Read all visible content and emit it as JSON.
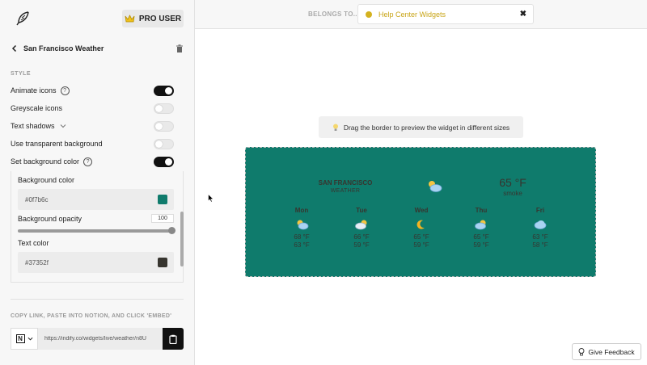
{
  "header": {
    "logo_icon": "feather-icon",
    "pro_badge_label": "PRO USER",
    "pro_badge_icon": "crown-icon"
  },
  "widget_header": {
    "title": "San Francisco Weather",
    "back_icon": "chevron-left-icon",
    "delete_icon": "trash-icon"
  },
  "style_section": {
    "label": "STYLE",
    "options": [
      {
        "label": "Animate icons",
        "has_help": true,
        "on": true
      },
      {
        "label": "Greyscale icons",
        "has_help": false,
        "on": false
      },
      {
        "label": "Text shadows",
        "has_dropdown": true,
        "on": false
      },
      {
        "label": "Use transparent background",
        "on": false
      },
      {
        "label": "Set background color",
        "has_help": true,
        "on": true
      }
    ],
    "background_color_label": "Background color",
    "background_color_value": "#0f7b6c",
    "background_opacity_label": "Background opacity",
    "background_opacity_value": "100",
    "text_color_label": "Text color",
    "text_color_value": "#37352f"
  },
  "embed": {
    "label": "COPY LINK, PASTE INTO NOTION, AND CLICK 'EMBED'",
    "url": "https://indify.co/widgets/live/weather/n8U",
    "notion_icon": "notion-icon",
    "copy_icon": "clipboard-icon"
  },
  "topbar": {
    "belongs_label": "BELONGS TO...",
    "folder_name": "Help Center Widgets",
    "folder_color": "#d4b21f",
    "close_label": "✖"
  },
  "hint": {
    "icon": "lightbulb-icon",
    "text": "Drag the border to preview the widget in different sizes"
  },
  "weather": {
    "bg_color": "#0f7b6c",
    "text_color": "#37352f",
    "city": "SAN FRANCISCO",
    "city_sub": "WEATHER",
    "current_temp": "65 °F",
    "current_condition": "smoke",
    "current_icon": "partly-cloudy-icon",
    "days": [
      {
        "name": "Mon",
        "icon": "partly-cloudy-icon",
        "high": "68 °F",
        "low": "63 °F"
      },
      {
        "name": "Tue",
        "icon": "cloudy-sun-icon",
        "high": "66 °F",
        "low": "59 °F"
      },
      {
        "name": "Wed",
        "icon": "moon-icon",
        "high": "65 °F",
        "low": "59 °F"
      },
      {
        "name": "Thu",
        "icon": "partly-cloudy-icon",
        "high": "65 °F",
        "low": "59 °F"
      },
      {
        "name": "Fri",
        "icon": "cloud-icon",
        "high": "63 °F",
        "low": "58 °F"
      }
    ]
  },
  "feedback": {
    "label": "Give Feedback",
    "icon": "lightbulb-icon"
  }
}
